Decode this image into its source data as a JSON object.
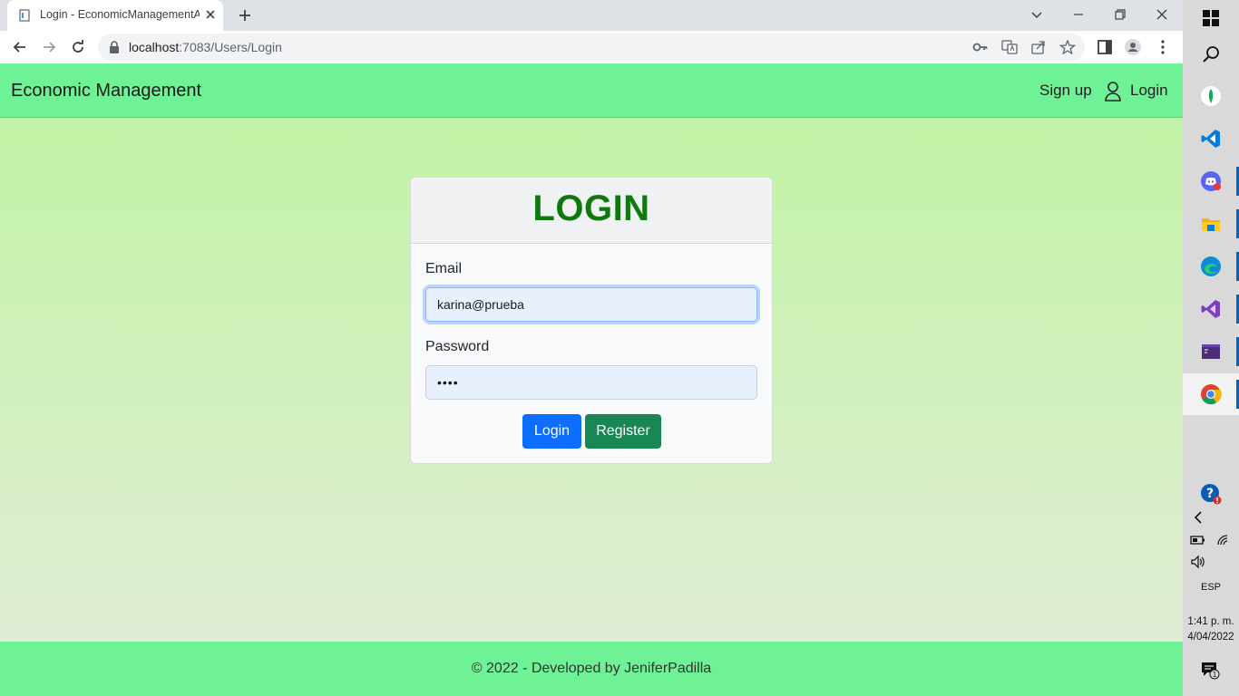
{
  "browser": {
    "tab_title": "Login - EconomicManagementAPI",
    "url_host": "localhost",
    "url_path": ":7083/Users/Login"
  },
  "navbar": {
    "brand": "Economic Management",
    "signup": "Sign up",
    "login": "Login"
  },
  "card": {
    "title": "LOGIN",
    "email_label": "Email",
    "email_value": "karina@prueba",
    "password_label": "Password",
    "password_value": "••••",
    "login_button": "Login",
    "register_button": "Register"
  },
  "footer": {
    "text": "© 2022 - Developed by JeniferPadilla"
  },
  "taskbar": {
    "language": "ESP",
    "time": "1:41 p. m.",
    "date": "4/04/2022"
  },
  "colors": {
    "navbar_bg": "#6ff196",
    "title_green": "#0e7a0e",
    "primary_blue": "#0d6efd",
    "success_green": "#198754"
  }
}
